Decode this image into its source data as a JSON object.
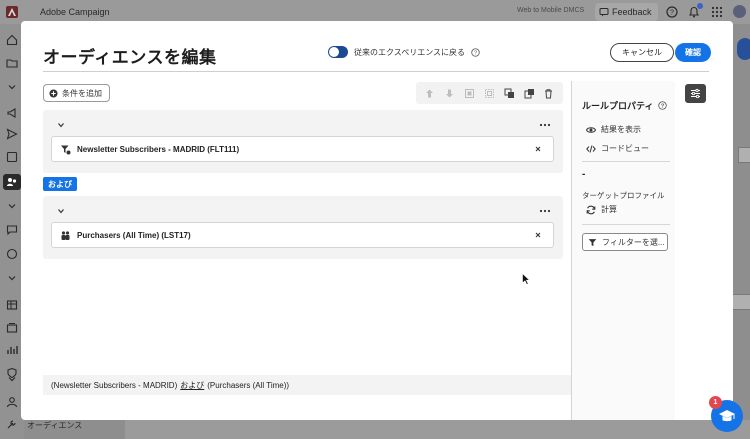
{
  "app": {
    "title": "Adobe Campaign",
    "top_badge": "Web to Mobile DMCS",
    "feedback_label": "Feedback",
    "rail_bottom_label": "オーディエンス"
  },
  "modal": {
    "title": "オーディエンスを編集",
    "toggle_label": "従来のエクスペリエンスに戻る",
    "cancel_label": "キャンセル",
    "confirm_label": "確認",
    "add_condition_label": "条件を追加",
    "groups": [
      {
        "condition": "Newsletter Subscribers - MADRID (FLT111)",
        "icon": "filter-icon"
      },
      {
        "condition": "Purchasers (All Time) (LST17)",
        "icon": "audience-icon"
      }
    ],
    "and_badge": "および",
    "footer": {
      "part1": "(Newsletter Subscribers - MADRID)",
      "and": "および",
      "part2": "(Purchasers (All Time))"
    }
  },
  "rule_properties": {
    "title": "ルールプロパティ",
    "show_results": "結果を表示",
    "code_view": "コードビュー",
    "count_value": "-",
    "target_profile": "ターゲットプロファイル",
    "calculate": "計算",
    "filter_button": "フィルターを選..."
  },
  "help": {
    "badge_count": "1"
  },
  "colors": {
    "accent": "#1473e6",
    "toggle": "#1c4a91"
  }
}
